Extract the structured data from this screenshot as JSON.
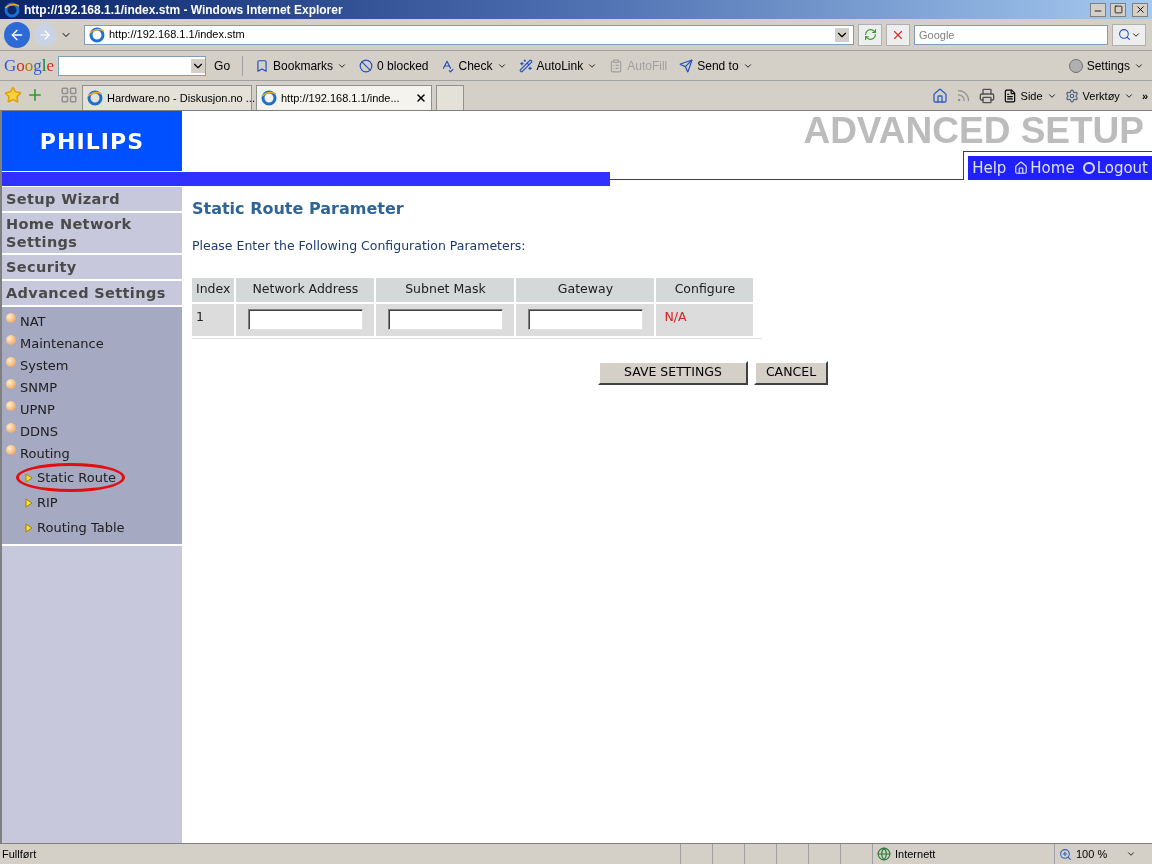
{
  "window": {
    "title": "http://192.168.1.1/index.stm - Windows Internet Explorer"
  },
  "address_bar": {
    "url": "http://192.168.1.1/index.stm",
    "search_placeholder": "Google"
  },
  "google_toolbar": {
    "logo": "Google",
    "go": "Go",
    "items": [
      {
        "label": "Bookmarks",
        "dropdown": true,
        "disabled": false
      },
      {
        "label": "0 blocked",
        "dropdown": false,
        "disabled": false
      },
      {
        "label": "Check",
        "dropdown": true,
        "disabled": false
      },
      {
        "label": "AutoLink",
        "dropdown": true,
        "disabled": false
      },
      {
        "label": "AutoFill",
        "dropdown": false,
        "disabled": true
      },
      {
        "label": "Send to",
        "dropdown": true,
        "disabled": false
      }
    ],
    "settings": "Settings"
  },
  "tabs": [
    {
      "label": "Hardware.no - Diskusjon.no ...",
      "selected": false
    },
    {
      "label": "http://192.168.1.1/inde...",
      "selected": true
    }
  ],
  "command_bar": {
    "page": "Side",
    "tools": "Verktøy",
    "more": "»"
  },
  "page": {
    "logo": "PHILIPS",
    "header_title": "ADVANCED SETUP",
    "nav": [
      "Help",
      "Home",
      "Logout"
    ],
    "sidebar": {
      "sections": [
        {
          "label": "Setup Wizard"
        },
        {
          "label": "Home Network Settings"
        },
        {
          "label": "Security"
        },
        {
          "label": "Advanced Settings"
        }
      ],
      "items": [
        {
          "label": "NAT"
        },
        {
          "label": "Maintenance"
        },
        {
          "label": "System"
        },
        {
          "label": "SNMP"
        },
        {
          "label": "UPNP"
        },
        {
          "label": "DDNS"
        },
        {
          "label": "Routing",
          "children": [
            {
              "label": "Static Route",
              "selected": true
            },
            {
              "label": "RIP",
              "selected": false
            },
            {
              "label": "Routing Table",
              "selected": false
            }
          ]
        }
      ]
    },
    "title": "Static Route Parameter",
    "instruction": "Please Enter the Following Configuration Parameters:",
    "table": {
      "columns": [
        "Index",
        "Network Address",
        "Subnet Mask",
        "Gateway",
        "Configure"
      ],
      "rows": [
        {
          "index": "1",
          "network_address": "",
          "subnet_mask": "",
          "gateway": "",
          "configure": "N/A"
        }
      ]
    },
    "buttons": [
      "SAVE SETTINGS",
      "CANCEL"
    ]
  },
  "status_bar": {
    "text": "Fullført",
    "zone": "Internett",
    "zoom": "100 %"
  }
}
